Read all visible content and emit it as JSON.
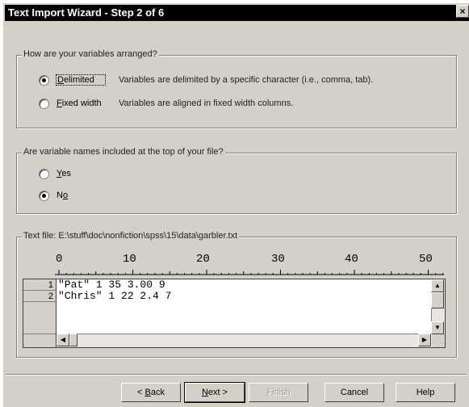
{
  "window": {
    "title": "Text Import Wizard - Step 2 of 6",
    "close_symbol": "×"
  },
  "arrangement": {
    "legend": "How are your variables arranged?",
    "options": [
      {
        "label": "Delimited",
        "desc": "Variables are delimited by a specific character (i.e., comma, tab).",
        "selected": true
      },
      {
        "label": "Fixed width",
        "desc": "Variables are aligned in fixed width columns.",
        "selected": false
      }
    ]
  },
  "names": {
    "legend": "Are variable names included at the top of your file?",
    "options": [
      {
        "label": "Yes",
        "selected": false
      },
      {
        "label": "No",
        "selected": true
      }
    ]
  },
  "preview": {
    "legend": "Text file: E:\\stuff\\doc\\nonfiction\\spss\\15\\data\\garbler.txt",
    "ruler": [
      "0",
      "10",
      "20",
      "30",
      "40",
      "50"
    ],
    "row_numbers": [
      "1",
      "2"
    ],
    "lines": [
      "\"Pat\" 1 35 3.00 9",
      "\"Chris\" 1 22 2.4 7"
    ]
  },
  "buttons": {
    "back": "< Back",
    "next": "Next >",
    "finish": "Finish",
    "cancel": "Cancel",
    "help": "Help"
  }
}
